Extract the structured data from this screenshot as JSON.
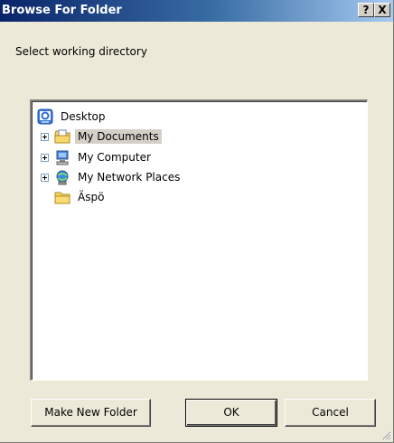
{
  "window": {
    "title": "Browse For Folder",
    "help_label": "?",
    "close_label": "X"
  },
  "instruction": "Select working directory",
  "tree": {
    "items": [
      {
        "label": "Desktop",
        "icon": "desktop-icon",
        "expandable": false,
        "selected": false
      },
      {
        "label": "My Documents",
        "icon": "my-documents-icon",
        "expandable": true,
        "selected": true
      },
      {
        "label": "My Computer",
        "icon": "my-computer-icon",
        "expandable": true,
        "selected": false
      },
      {
        "label": "My Network Places",
        "icon": "network-places-icon",
        "expandable": true,
        "selected": false
      },
      {
        "label": "Äspö",
        "icon": "folder-icon",
        "expandable": false,
        "selected": false
      }
    ]
  },
  "buttons": {
    "new_folder": "Make New Folder",
    "ok": "OK",
    "cancel": "Cancel"
  },
  "colors": {
    "title_bar_start": "#0a246a",
    "title_bar_end": "#a6caf0",
    "dialog_face": "#ece9d8",
    "selection_highlight": "#d4d0c8"
  }
}
